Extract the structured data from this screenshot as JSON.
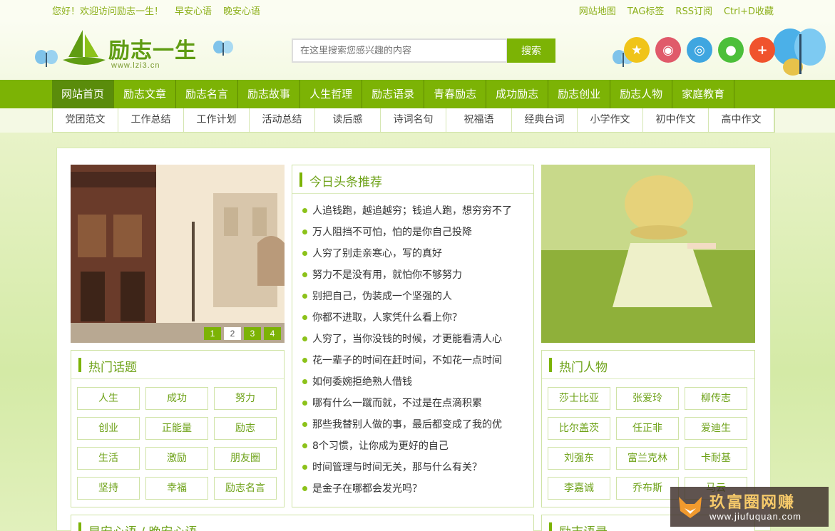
{
  "topbar": {
    "left": [
      "您好！欢迎访问励志一生！",
      "早安心语",
      "晚安心语"
    ],
    "right": [
      "网站地图",
      "TAG标签",
      "RSS订阅",
      "Ctrl+D收藏"
    ]
  },
  "logo": {
    "name": "励志一生",
    "url": "www.lzi3.cn"
  },
  "search": {
    "placeholder": "在这里搜索您感兴趣的内容",
    "button": "搜索"
  },
  "socials": [
    {
      "icon": "star-icon",
      "color": "#f0c419"
    },
    {
      "icon": "weibo-icon",
      "color": "#e05a6a"
    },
    {
      "icon": "tencent-weibo-icon",
      "color": "#3fa6e0"
    },
    {
      "icon": "wechat-icon",
      "color": "#4cbf3a"
    },
    {
      "icon": "plus-icon",
      "color": "#f0532d"
    }
  ],
  "nav": [
    "网站首页",
    "励志文章",
    "励志名言",
    "励志故事",
    "人生哲理",
    "励志语录",
    "青春励志",
    "成功励志",
    "励志创业",
    "励志人物",
    "家庭教育"
  ],
  "subnav": [
    "党团范文",
    "工作总结",
    "工作计划",
    "活动总结",
    "读后感",
    "诗词名句",
    "祝福语",
    "经典台词",
    "小学作文",
    "初中作文",
    "高中作文"
  ],
  "slider": {
    "dots": [
      "1",
      "2",
      "3",
      "4"
    ],
    "active": "2"
  },
  "headlines": {
    "title": "今日头条推荐",
    "items": [
      "人追钱跑，越追越穷；钱追人跑，想穷穷不了",
      "万人阻挡不可怕，怕的是你自己投降",
      "人穷了别走亲寒心，写的真好",
      "努力不是没有用，就怕你不够努力",
      "别把自己，伪装成一个坚强的人",
      "你都不进取，人家凭什么看上你？",
      "人穷了，当你没钱的时候，才更能看清人心",
      "花一辈子的时间在赶时间，不如花一点时间",
      "如何委婉拒绝熟人借钱",
      "哪有什么一蹴而就，不过是在点滴积累",
      "那些我替别人做的事，最后都变成了我的优",
      "8个习惯，让你成为更好的自己",
      "时间管理与时间无关，那与什么有关？",
      "是金子在哪都会发光吗？"
    ]
  },
  "hot_topics": {
    "title": "热门话题",
    "tags": [
      "人生",
      "成功",
      "努力",
      "创业",
      "正能量",
      "励志",
      "生活",
      "激励",
      "朋友圈",
      "坚持",
      "幸福",
      "励志名言"
    ]
  },
  "hot_people": {
    "title": "热门人物",
    "tags": [
      "莎士比亚",
      "张爱玲",
      "柳传志",
      "比尔盖茨",
      "任正非",
      "爱迪生",
      "刘强东",
      "富兰克林",
      "卡耐基",
      "李嘉诚",
      "乔布斯",
      "马云"
    ]
  },
  "bottom_left": {
    "title": "早安心语 / 晚安心语"
  },
  "bottom_right": {
    "title": "励志语录"
  },
  "watermark": {
    "title": "玖富圈网赚",
    "url": "www.jiufuquan.com"
  },
  "colors": {
    "accent": "#7cb305",
    "nav_active": "#5a8c0b"
  }
}
